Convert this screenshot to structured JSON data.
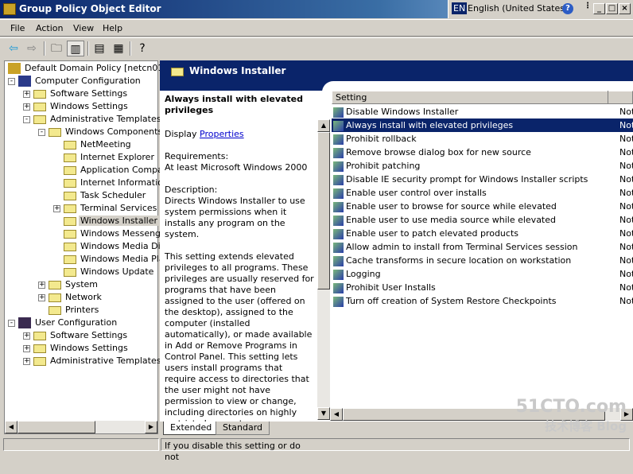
{
  "window": {
    "title": "Group Policy Object Editor",
    "language_code": "EN",
    "language": "English (United States)"
  },
  "menu": [
    "File",
    "Action",
    "View",
    "Help"
  ],
  "toolbar": {
    "icons": [
      "back-icon",
      "forward-icon",
      "up-folder-icon",
      "show-hide-tree-icon",
      "properties-icon",
      "export-list-icon",
      "help-icon"
    ]
  },
  "tree": [
    {
      "label": "Default Domain Policy [netcn01.guc",
      "level": 0,
      "icon": "policy-icon",
      "toggle": ""
    },
    {
      "label": "Computer Configuration",
      "level": 0,
      "icon": "computer-icon",
      "toggle": "-"
    },
    {
      "label": "Software Settings",
      "level": 1,
      "icon": "folder",
      "toggle": "+"
    },
    {
      "label": "Windows Settings",
      "level": 1,
      "icon": "folder",
      "toggle": "+"
    },
    {
      "label": "Administrative Templates",
      "level": 1,
      "icon": "folder",
      "toggle": "-"
    },
    {
      "label": "Windows Components",
      "level": 2,
      "icon": "folder",
      "toggle": "-"
    },
    {
      "label": "NetMeeting",
      "level": 3,
      "icon": "folder",
      "toggle": ""
    },
    {
      "label": "Internet Explorer",
      "level": 3,
      "icon": "folder",
      "toggle": ""
    },
    {
      "label": "Application Compati",
      "level": 3,
      "icon": "folder",
      "toggle": ""
    },
    {
      "label": "Internet Informatio",
      "level": 3,
      "icon": "folder",
      "toggle": ""
    },
    {
      "label": "Task Scheduler",
      "level": 3,
      "icon": "folder",
      "toggle": ""
    },
    {
      "label": "Terminal Services",
      "level": 3,
      "icon": "folder",
      "toggle": "+"
    },
    {
      "label": "Windows Installer",
      "level": 3,
      "icon": "folder-open",
      "toggle": "",
      "selected": true
    },
    {
      "label": "Windows Messenge",
      "level": 3,
      "icon": "folder",
      "toggle": ""
    },
    {
      "label": "Windows Media Digi",
      "level": 3,
      "icon": "folder",
      "toggle": ""
    },
    {
      "label": "Windows Media Play",
      "level": 3,
      "icon": "folder",
      "toggle": ""
    },
    {
      "label": "Windows Update",
      "level": 3,
      "icon": "folder",
      "toggle": ""
    },
    {
      "label": "System",
      "level": 2,
      "icon": "folder",
      "toggle": "+"
    },
    {
      "label": "Network",
      "level": 2,
      "icon": "folder",
      "toggle": "+"
    },
    {
      "label": "Printers",
      "level": 2,
      "icon": "folder",
      "toggle": ""
    },
    {
      "label": "User Configuration",
      "level": 0,
      "icon": "user-icon",
      "toggle": "-"
    },
    {
      "label": "Software Settings",
      "level": 1,
      "icon": "folder",
      "toggle": "+"
    },
    {
      "label": "Windows Settings",
      "level": 1,
      "icon": "folder",
      "toggle": "+"
    },
    {
      "label": "Administrative Templates",
      "level": 1,
      "icon": "folder",
      "toggle": "+"
    }
  ],
  "header": {
    "title": "Windows Installer"
  },
  "description": {
    "title": "Always install with elevated privileges",
    "display_prefix": "Display ",
    "display_link": "Properties",
    "requirements_label": "Requirements:",
    "requirements": "At least Microsoft Windows 2000",
    "description_label": "Description:",
    "para1": "Directs Windows Installer to use system permissions when it installs any program on the system.",
    "para2": "This setting extends elevated privileges to all programs. These privileges are usually reserved for programs that have been assigned to the user (offered on the desktop), assigned to the computer (installed automatically), or made available in Add or Remove Programs in Control Panel. This setting lets users install programs that require access to directories that the user might not have permission to view or change, including directories on highly restricted computers.",
    "para3": "If you disable this setting or do not"
  },
  "list": {
    "columns": [
      "Setting",
      ""
    ],
    "rows": [
      {
        "setting": "Disable Windows Installer",
        "state": "Not"
      },
      {
        "setting": "Always install with elevated privileges",
        "state": "Not",
        "selected": true
      },
      {
        "setting": "Prohibit rollback",
        "state": "Not"
      },
      {
        "setting": "Remove browse dialog box for new source",
        "state": "Not"
      },
      {
        "setting": "Prohibit patching",
        "state": "Not"
      },
      {
        "setting": "Disable IE security prompt for Windows Installer scripts",
        "state": "Not"
      },
      {
        "setting": "Enable user control over installs",
        "state": "Not"
      },
      {
        "setting": "Enable user to browse for source while elevated",
        "state": "Not"
      },
      {
        "setting": "Enable user to use media source while elevated",
        "state": "Not"
      },
      {
        "setting": "Enable user to patch elevated products",
        "state": "Not"
      },
      {
        "setting": "Allow admin to install from Terminal Services session",
        "state": "Not"
      },
      {
        "setting": "Cache transforms in secure location on workstation",
        "state": "Not"
      },
      {
        "setting": "Logging",
        "state": "Not"
      },
      {
        "setting": "Prohibit User Installs",
        "state": "Not"
      },
      {
        "setting": "Turn off creation of System Restore Checkpoints",
        "state": "Not"
      }
    ]
  },
  "tabs": [
    "Extended",
    "Standard"
  ],
  "watermark": {
    "line1": "51CTO.com",
    "line2": "技术博客  Blog"
  },
  "colors": {
    "selection": "#0a246a",
    "title_gradient_start": "#0a246a",
    "link": "#0000cc"
  }
}
